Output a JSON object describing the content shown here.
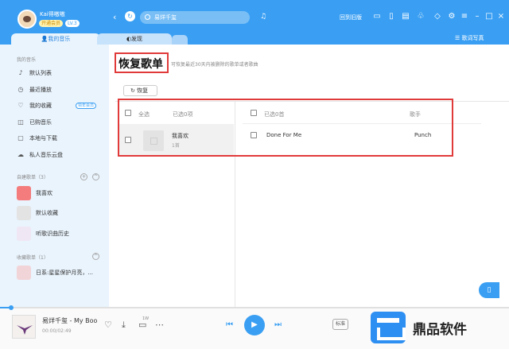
{
  "header": {
    "username": "Kai得嗷嗷",
    "vip_badge": "开通会员",
    "level_badge": "LV.3",
    "search_text": "易烊千玺",
    "old_version_label": "回到旧版"
  },
  "tabs": {
    "my_music": "我的音乐",
    "discover": "发现",
    "lyrics_btn": "歌词写真"
  },
  "sidebar": {
    "section_my_music": "我的音乐",
    "items": [
      {
        "label": "默认列表",
        "icon": "list-icon"
      },
      {
        "label": "最近播放",
        "icon": "clock-icon"
      },
      {
        "label": "我的收藏",
        "icon": "heart-icon"
      },
      {
        "label": "已购音乐",
        "icon": "bag-icon"
      },
      {
        "label": "本地与下载",
        "icon": "folder-icon"
      },
      {
        "label": "私人音乐云盘",
        "icon": "cloud-icon"
      }
    ],
    "vip_tag": "领年会员",
    "section_created": "自建歌单（3）",
    "created": [
      {
        "label": "我喜欢"
      },
      {
        "label": "默认收藏"
      },
      {
        "label": "听歌识曲历史"
      }
    ],
    "section_collected": "收藏歌单（1）",
    "collected": [
      {
        "label": "日系:星星保护月亮，..."
      }
    ]
  },
  "main": {
    "title": "恢复歌单",
    "subtitle": "可恢复最近30天内被删除的歌单或者歌曲",
    "restore_btn": "恢复",
    "left_select_all": "全选",
    "left_selected": "已选0项",
    "playlist_name": "我喜欢",
    "playlist_count": "1首",
    "right_selected": "已选0首",
    "right_col_artist": "歌手",
    "song_name": "Done For Me",
    "song_artist": "Punch"
  },
  "player": {
    "now_playing": "易烊千玺 - My Boo",
    "time": "00:00/02:49",
    "download_count": "1W",
    "quality": "标准",
    "progress": 0.02
  },
  "watermark": {
    "text": "鼎品软件"
  },
  "colors": {
    "accent": "#3a9ff3",
    "highlight": "#e03a3a"
  }
}
